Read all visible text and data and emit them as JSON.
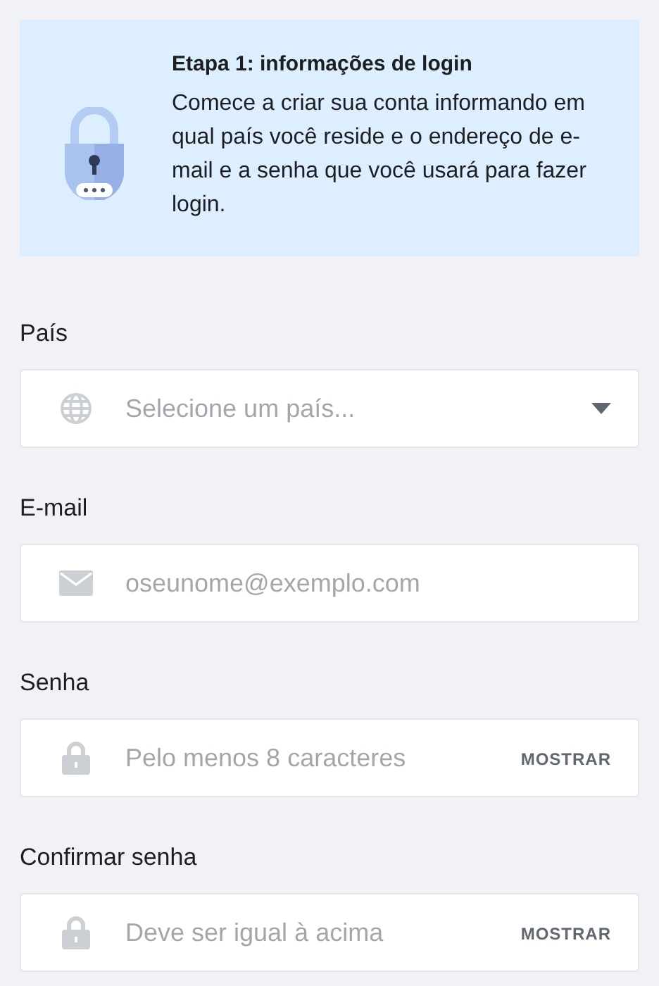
{
  "banner": {
    "title": "Etapa 1: informações de login",
    "text": "Comece a criar sua conta informando em qual país você reside e o endereço de e-mail e a senha que você usará para fazer login."
  },
  "fields": [
    {
      "kind": "select",
      "label": "País",
      "placeholder": "Selecione um país..."
    },
    {
      "kind": "email",
      "label": "E-mail",
      "placeholder": "oseunome@exemplo.com"
    },
    {
      "kind": "password",
      "label": "Senha",
      "placeholder": "Pelo menos 8 caracteres",
      "toggle": "MOSTRAR"
    },
    {
      "kind": "password",
      "label": "Confirmar senha",
      "placeholder": "Deve ser igual à acima",
      "toggle": "MOSTRAR"
    }
  ]
}
